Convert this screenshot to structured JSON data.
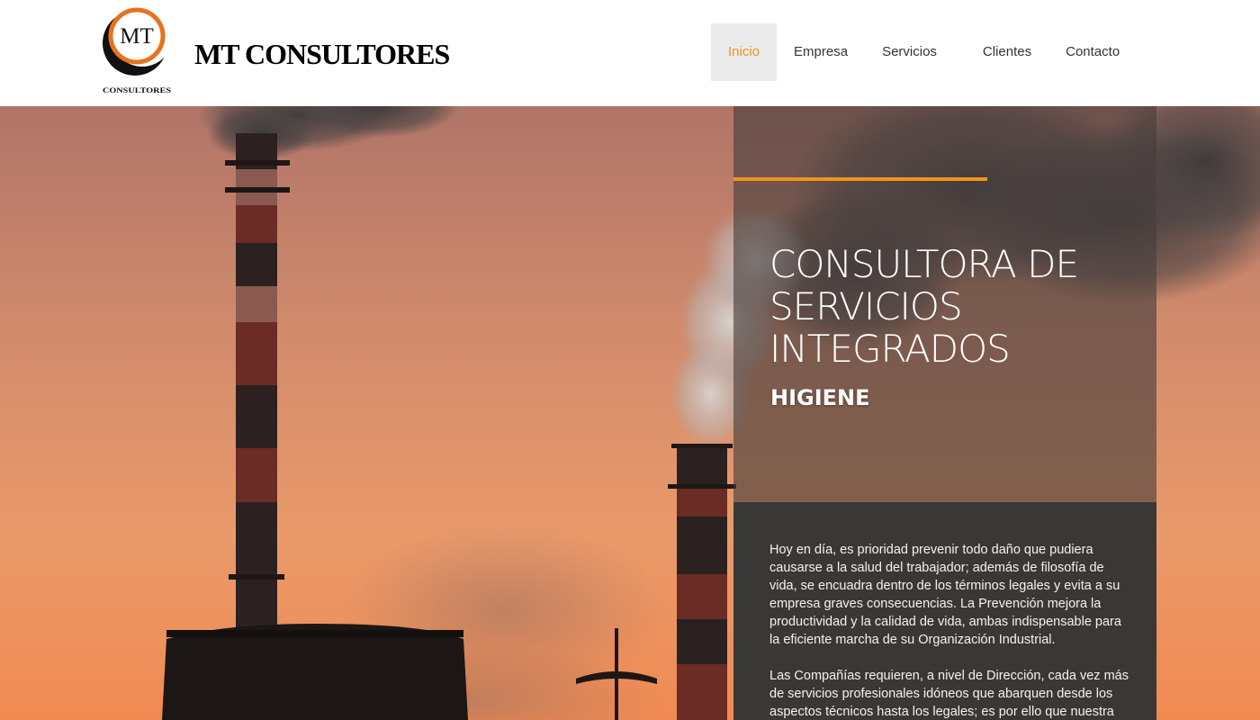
{
  "brand": {
    "logo_text": "MT",
    "logo_caption": "CONSULTORES",
    "name": "MT CONSULTORES"
  },
  "nav": {
    "items": [
      {
        "label": "Inicio",
        "active": true
      },
      {
        "label": "Empresa",
        "active": false
      },
      {
        "label": "Servicios",
        "active": false
      },
      {
        "label": "Clientes",
        "active": false
      },
      {
        "label": "Contacto",
        "active": false
      }
    ]
  },
  "hero": {
    "headline_lines": [
      "CONSULTORA DE",
      "SERVICIOS",
      "INTEGRADOS"
    ],
    "subheading": "HIGIENE",
    "paragraph_1": "Hoy en día, es prioridad prevenir todo daño que pudiera causarse a la salud del trabajador; además de filosofía de vida, se encuadra dentro de los términos legales y evita a su empresa graves consecuencias. La Prevención mejora la productividad y la calidad de vida, ambas indispensable para la eficiente marcha de su Organización Industrial.",
    "paragraph_2": "Las Compañías requieren, a nivel de Dirección, cada vez más de servicios profesionales idóneos que abarquen desde los aspectos técnicos hasta los legales; es por ello que nuestra"
  },
  "colors": {
    "accent": "#f0941a",
    "nav_active_bg": "#ebebeb",
    "panel_dark": "#3a3837"
  },
  "icons": [
    "logo-mark"
  ]
}
